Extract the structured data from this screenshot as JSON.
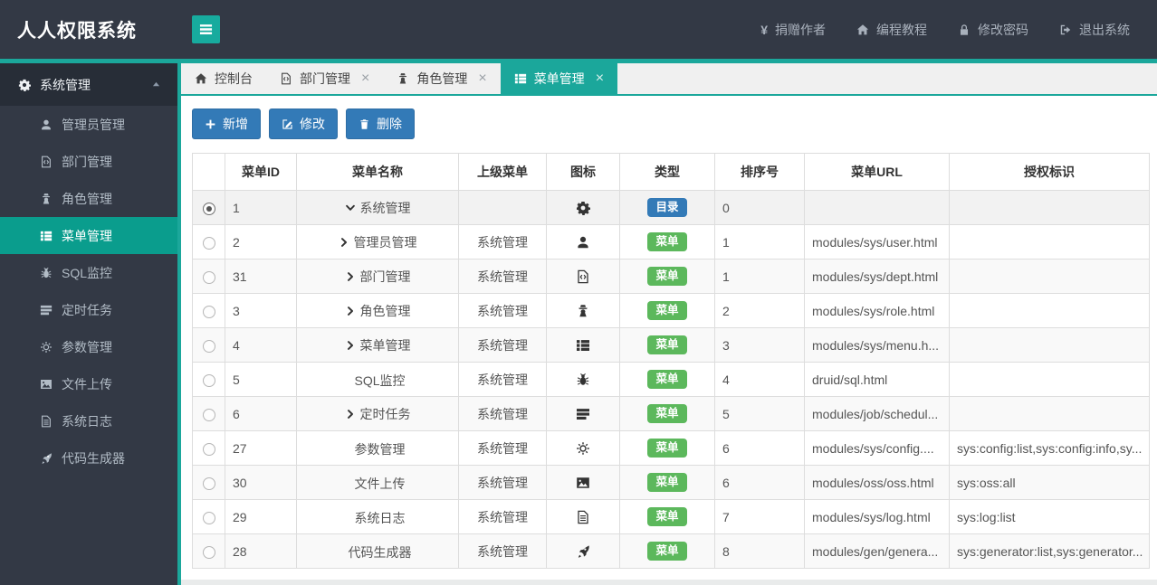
{
  "theme": {
    "teal": "#1ba79b",
    "sidebar_active_teal": "#0a9d8d",
    "button_blue": "#337ab7",
    "type_colors": {
      "目录": "#337ab7",
      "菜单": "#5cb85c"
    }
  },
  "header": {
    "title": "人人权限系统",
    "nav": [
      {
        "icon": "yen",
        "label": "捐赠作者"
      },
      {
        "icon": "home",
        "label": "编程教程"
      },
      {
        "icon": "lock",
        "label": "修改密码"
      },
      {
        "icon": "sign-out",
        "label": "退出系统"
      }
    ]
  },
  "sidebar": {
    "group": {
      "icon": "cog",
      "label": "系统管理",
      "expanded": true
    },
    "items": [
      {
        "icon": "user",
        "label": "管理员管理",
        "active": false
      },
      {
        "icon": "file-code",
        "label": "部门管理",
        "active": false
      },
      {
        "icon": "user-secret",
        "label": "角色管理",
        "active": false
      },
      {
        "icon": "th-list",
        "label": "菜单管理",
        "active": true
      },
      {
        "icon": "bug",
        "label": "SQL监控",
        "active": false
      },
      {
        "icon": "tasks",
        "label": "定时任务",
        "active": false
      },
      {
        "icon": "sun",
        "label": "参数管理",
        "active": false
      },
      {
        "icon": "image",
        "label": "文件上传",
        "active": false
      },
      {
        "icon": "file-text",
        "label": "系统日志",
        "active": false
      },
      {
        "icon": "rocket",
        "label": "代码生成器",
        "active": false
      }
    ]
  },
  "tabs": [
    {
      "icon": "home",
      "label": "控制台",
      "closable": false,
      "active": false
    },
    {
      "icon": "file-code",
      "label": "部门管理",
      "closable": true,
      "active": false
    },
    {
      "icon": "user-secret",
      "label": "角色管理",
      "closable": true,
      "active": false
    },
    {
      "icon": "th-list",
      "label": "菜单管理",
      "closable": true,
      "active": true
    }
  ],
  "toolbar": [
    {
      "icon": "plus",
      "label": "新增"
    },
    {
      "icon": "edit",
      "label": "修改"
    },
    {
      "icon": "trash",
      "label": "删除"
    }
  ],
  "table": {
    "columns": [
      "",
      "菜单ID",
      "菜单名称",
      "上级菜单",
      "图标",
      "类型",
      "排序号",
      "菜单URL",
      "授权标识"
    ],
    "rows": [
      {
        "selected": true,
        "id": "1",
        "caret": "down",
        "name": "系统管理",
        "parent": "",
        "icon": "cog",
        "type": "目录",
        "order": "0",
        "url": "",
        "perms": ""
      },
      {
        "selected": false,
        "id": "2",
        "caret": "right",
        "name": "管理员管理",
        "parent": "系统管理",
        "icon": "user",
        "type": "菜单",
        "order": "1",
        "url": "modules/sys/user.html",
        "perms": ""
      },
      {
        "selected": false,
        "id": "31",
        "caret": "right",
        "name": "部门管理",
        "parent": "系统管理",
        "icon": "file-code",
        "type": "菜单",
        "order": "1",
        "url": "modules/sys/dept.html",
        "perms": ""
      },
      {
        "selected": false,
        "id": "3",
        "caret": "right",
        "name": "角色管理",
        "parent": "系统管理",
        "icon": "user-secret",
        "type": "菜单",
        "order": "2",
        "url": "modules/sys/role.html",
        "perms": ""
      },
      {
        "selected": false,
        "id": "4",
        "caret": "right",
        "name": "菜单管理",
        "parent": "系统管理",
        "icon": "th-list",
        "type": "菜单",
        "order": "3",
        "url": "modules/sys/menu.h...",
        "perms": ""
      },
      {
        "selected": false,
        "id": "5",
        "caret": "none",
        "name": "SQL监控",
        "parent": "系统管理",
        "icon": "bug",
        "type": "菜单",
        "order": "4",
        "url": "druid/sql.html",
        "perms": ""
      },
      {
        "selected": false,
        "id": "6",
        "caret": "right",
        "name": "定时任务",
        "parent": "系统管理",
        "icon": "tasks",
        "type": "菜单",
        "order": "5",
        "url": "modules/job/schedul...",
        "perms": ""
      },
      {
        "selected": false,
        "id": "27",
        "caret": "none",
        "name": "参数管理",
        "parent": "系统管理",
        "icon": "sun",
        "type": "菜单",
        "order": "6",
        "url": "modules/sys/config....",
        "perms": "sys:config:list,sys:config:info,sy..."
      },
      {
        "selected": false,
        "id": "30",
        "caret": "none",
        "name": "文件上传",
        "parent": "系统管理",
        "icon": "image",
        "type": "菜单",
        "order": "6",
        "url": "modules/oss/oss.html",
        "perms": "sys:oss:all"
      },
      {
        "selected": false,
        "id": "29",
        "caret": "none",
        "name": "系统日志",
        "parent": "系统管理",
        "icon": "file-text",
        "type": "菜单",
        "order": "7",
        "url": "modules/sys/log.html",
        "perms": "sys:log:list"
      },
      {
        "selected": false,
        "id": "28",
        "caret": "none",
        "name": "代码生成器",
        "parent": "系统管理",
        "icon": "rocket",
        "type": "菜单",
        "order": "8",
        "url": "modules/gen/genera...",
        "perms": "sys:generator:list,sys:generator..."
      }
    ]
  }
}
